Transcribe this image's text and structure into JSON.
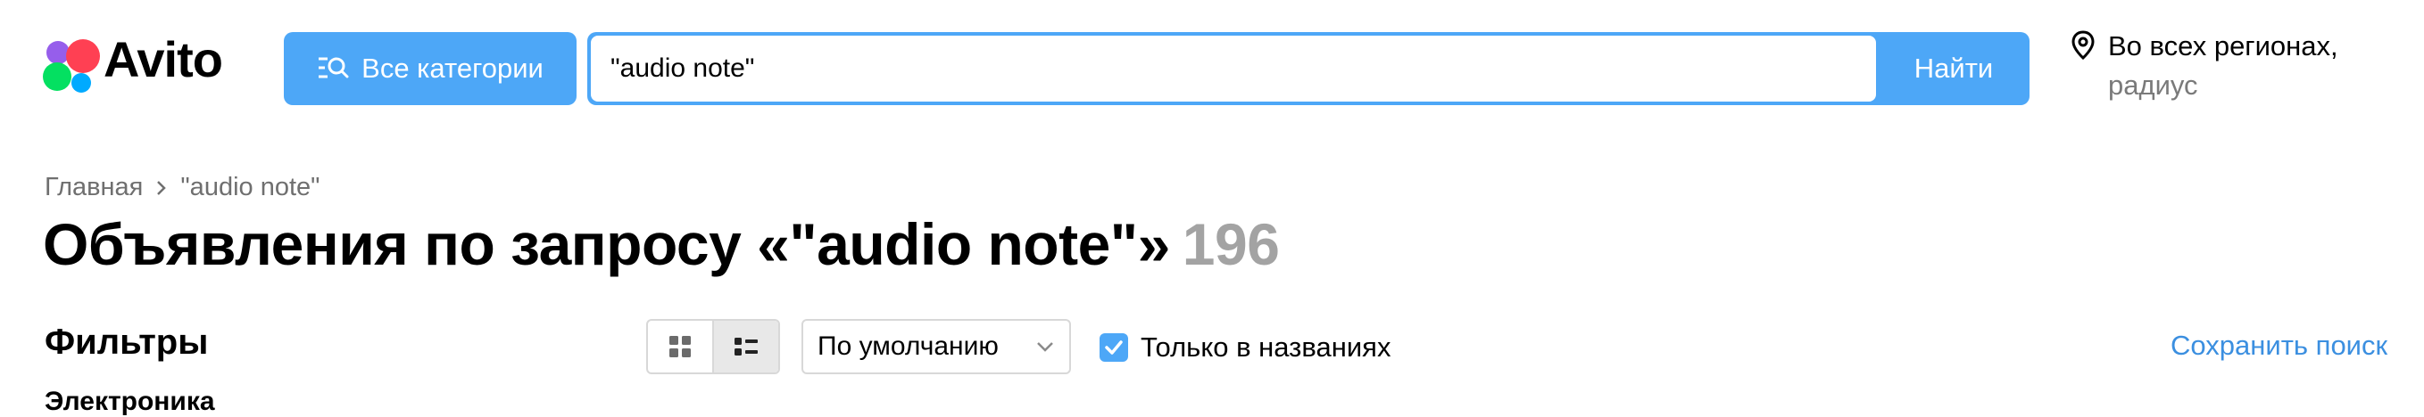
{
  "header": {
    "logo_text": "Avito",
    "categories_button": "Все категории",
    "search": {
      "value": "\"audio note\""
    },
    "search_button": "Найти",
    "region": {
      "line1": "Во всех регионах,",
      "line2": "радиус"
    }
  },
  "breadcrumb": {
    "home": "Главная",
    "current": "\"audio note\""
  },
  "page": {
    "title": "Объявления по запросу «\"audio note\"»",
    "count": "196"
  },
  "filters": {
    "heading": "Фильтры",
    "first_category": "Электроника"
  },
  "toolbar": {
    "sort_value": "По умолчанию",
    "only_in_titles_label": "Только в названиях",
    "only_in_titles_checked": true,
    "save_search": "Сохранить поиск"
  },
  "colors": {
    "accent": "#4da7f7",
    "link": "#3b8fe0",
    "muted": "#a3a3a3"
  },
  "icons": [
    "avito-logo-icon",
    "categories-search-icon",
    "location-pin-icon",
    "chevron-right-icon",
    "grid-view-icon",
    "list-view-icon",
    "chevron-down-icon",
    "checkmark-icon"
  ]
}
